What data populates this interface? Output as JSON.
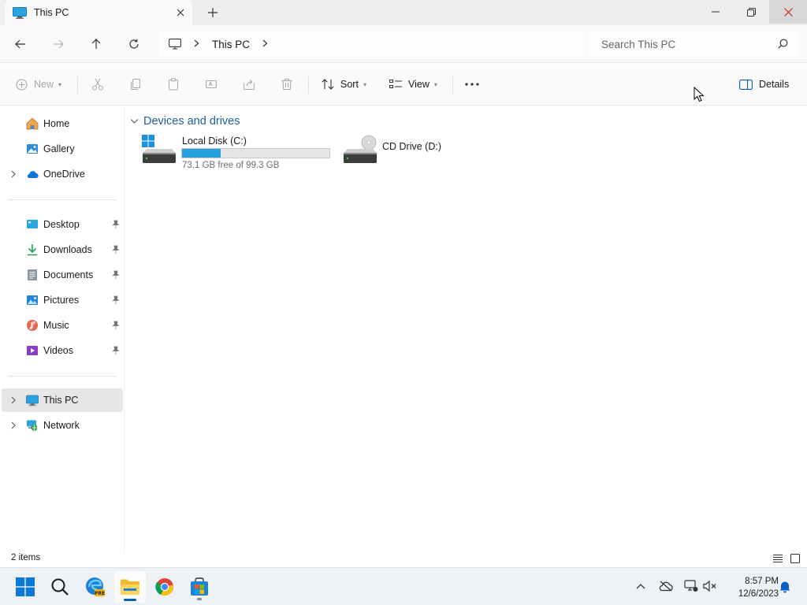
{
  "window": {
    "tab_title": "This PC",
    "tab_icon": "monitor-icon",
    "new_tab_icon": "plus-icon"
  },
  "navigation": {
    "back_icon": "arrow-left-icon",
    "forward_icon": "arrow-right-icon",
    "up_icon": "arrow-up-icon",
    "refresh_icon": "refresh-icon",
    "breadcrumb": [
      "This PC"
    ],
    "search_placeholder": "Search This PC"
  },
  "commandbar": {
    "new_label": "New",
    "sort_label": "Sort",
    "view_label": "View",
    "details_label": "Details",
    "disabled_commands": [
      "cut-icon",
      "copy-icon",
      "paste-icon",
      "rename-icon",
      "share-icon",
      "delete-icon"
    ]
  },
  "sidebar": {
    "top_items": [
      {
        "label": "Home",
        "icon": "home-icon"
      },
      {
        "label": "Gallery",
        "icon": "gallery-icon"
      },
      {
        "label": "OneDrive",
        "icon": "cloud-icon"
      }
    ],
    "pinned_items": [
      {
        "label": "Desktop",
        "icon": "desktop-icon"
      },
      {
        "label": "Downloads",
        "icon": "download-icon"
      },
      {
        "label": "Documents",
        "icon": "document-icon"
      },
      {
        "label": "Pictures",
        "icon": "pictures-icon"
      },
      {
        "label": "Music",
        "icon": "music-icon"
      },
      {
        "label": "Videos",
        "icon": "videos-icon"
      }
    ],
    "bottom_items": [
      {
        "label": "This PC",
        "icon": "monitor-icon",
        "selected": true
      },
      {
        "label": "Network",
        "icon": "network-icon"
      }
    ]
  },
  "main": {
    "section_title": "Devices and drives",
    "drives": [
      {
        "name": "Local Disk (C:)",
        "free_text": "73.1 GB free of 99.3 GB",
        "used_fraction": 0.264
      },
      {
        "name": "CD Drive (D:)"
      }
    ]
  },
  "status": {
    "item_count": "2 items"
  },
  "taskbar": {
    "apps": [
      "start-icon",
      "search-icon",
      "edge-dev-icon",
      "file-explorer-icon",
      "chrome-icon",
      "store-icon"
    ],
    "time": "8:57 PM",
    "date": "12/6/2023"
  },
  "colors": {
    "accent": "#005fb8",
    "drive_bar_fill": "#26a0da",
    "section_title": "#1f5c99",
    "selected_bg": "#e6e6e6"
  }
}
